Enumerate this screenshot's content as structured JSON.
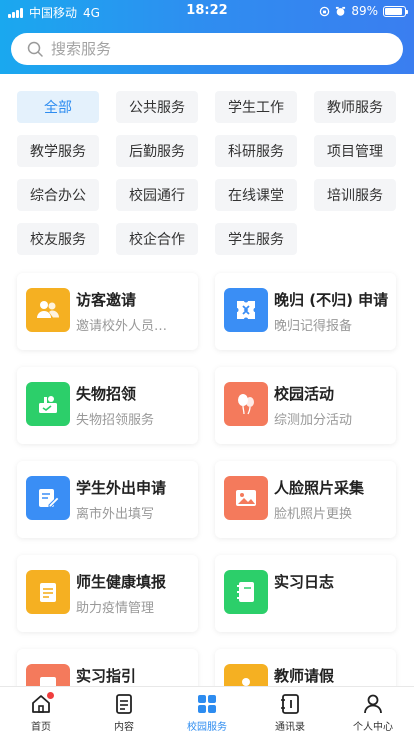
{
  "status": {
    "carrier": "中国移动",
    "network": "4G",
    "time": "18:22",
    "battery": "89%",
    "battery_level": 0.89
  },
  "search": {
    "placeholder": "搜索服务"
  },
  "categories": [
    "全部",
    "公共服务",
    "学生工作",
    "教师服务",
    "教学服务",
    "后勤服务",
    "科研服务",
    "项目管理",
    "综合办公",
    "校园通行",
    "在线课堂",
    "培训服务",
    "校友服务",
    "校企合作",
    "学生服务"
  ],
  "active_category": "全部",
  "cards": [
    {
      "title": "访客邀请",
      "subtitle": "邀请校外人员…",
      "icon": "visitor-icon",
      "color": "#f5b022"
    },
    {
      "title": "晚归 (不归) 申请",
      "subtitle": "晚归记得报备",
      "icon": "puzzle-icon",
      "color": "#3a8ef5"
    },
    {
      "title": "失物招领",
      "subtitle": "失物招领服务",
      "icon": "lost-found-icon",
      "color": "#2ccf6a"
    },
    {
      "title": "校园活动",
      "subtitle": "综测加分活动",
      "icon": "balloon-icon",
      "color": "#f47a5c"
    },
    {
      "title": "学生外出申请",
      "subtitle": "离市外出填写",
      "icon": "edit-form-icon",
      "color": "#3a8ef5"
    },
    {
      "title": "人脸照片采集",
      "subtitle": "脸机照片更换",
      "icon": "photo-icon",
      "color": "#f47a5c"
    },
    {
      "title": "师生健康填报",
      "subtitle": "助力疫情管理",
      "icon": "health-form-icon",
      "color": "#f5b022"
    },
    {
      "title": "实习日志",
      "subtitle": "",
      "icon": "notebook-icon",
      "color": "#2ccf6a"
    },
    {
      "title": "实习指引",
      "subtitle": "",
      "icon": "guide-icon",
      "color": "#f47a5c"
    },
    {
      "title": "教师请假",
      "subtitle": "",
      "icon": "leave-icon",
      "color": "#f5b022"
    }
  ],
  "tabs": [
    {
      "label": "首页",
      "icon": "home-icon",
      "badge": true
    },
    {
      "label": "内容",
      "icon": "document-icon",
      "badge": false
    },
    {
      "label": "校园服务",
      "icon": "grid-icon",
      "badge": false
    },
    {
      "label": "通讯录",
      "icon": "contacts-icon",
      "badge": false
    },
    {
      "label": "个人中心",
      "icon": "user-icon",
      "badge": false
    }
  ],
  "active_tab": "校园服务",
  "colors": {
    "accent": "#2d8cf0",
    "header_start": "#1aa8ef",
    "header_end": "#3a7ef0"
  }
}
